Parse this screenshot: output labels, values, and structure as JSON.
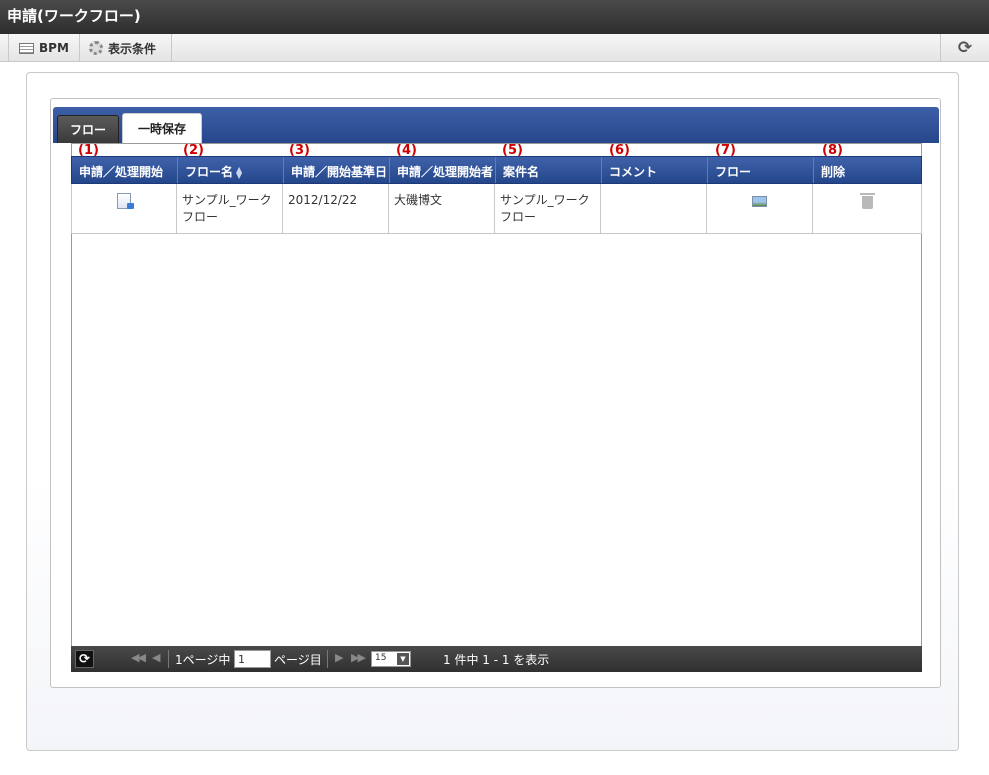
{
  "window": {
    "title": "申請(ワークフロー)"
  },
  "toolbar": {
    "bpm_label": "BPM",
    "display_condition_label": "表示条件"
  },
  "tabs": [
    {
      "label": "フロー",
      "active": false
    },
    {
      "label": "一時保存",
      "active": true
    }
  ],
  "annotations": [
    "(1)",
    "(2)",
    "(3)",
    "(4)",
    "(5)",
    "(6)",
    "(7)",
    "(8)"
  ],
  "table": {
    "columns": [
      "申請／処理開始",
      "フロー名",
      "申請／開始基準日",
      "申請／処理開始者",
      "案件名",
      "コメント",
      "フロー",
      "削除"
    ],
    "sorted_column": "フロー名",
    "rows": [
      {
        "start_icon": "document-arrow-icon",
        "flow_name": "サンプル_ワークフロー",
        "base_date": "2012/12/22",
        "starter": "大磯博文",
        "matter_name": "サンプル_ワークフロー",
        "comment": "",
        "flow_icon": "flow-image-icon",
        "delete_icon": "trash-icon"
      }
    ]
  },
  "pager": {
    "page_prefix": "1ページ中",
    "page_value": "1",
    "page_suffix": "ページ目",
    "rows_per_page": "15",
    "summary": "1 件中 1 - 1 を表示"
  },
  "colors": {
    "header_blue": "#2d4f96",
    "annotation_red": "#d00000",
    "pager_dark": "#3a3a3a"
  }
}
